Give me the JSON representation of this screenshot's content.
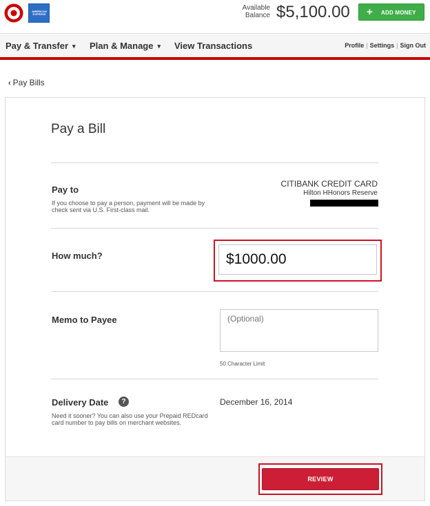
{
  "header": {
    "available_label": "Available\nBalance",
    "balance": "$5,100.00",
    "add_money_label": "ADD MONEY",
    "amex_text": "AMERICAN EXPRESS",
    "icons": {
      "target_logo": "target-logo",
      "amex_logo": "amex-logo",
      "add_icon": "plus-icon"
    },
    "colors": {
      "accent_red": "#cc0000",
      "add_money_green": "#3fae49"
    }
  },
  "nav": {
    "pay_transfer": "Pay & Transfer",
    "plan_manage": "Plan & Manage",
    "view_transactions": "View Transactions",
    "caret": "▾",
    "util": {
      "profile": "Profile",
      "settings": "Settings",
      "sign_out": "Sign Out",
      "separator": "|"
    }
  },
  "breadcrumb": {
    "chevron": "‹",
    "label": "Pay Bills"
  },
  "form": {
    "title": "Pay a Bill",
    "pay_to": {
      "heading": "Pay to",
      "note": "If you choose to pay a person, payment will be made by check sent via U.S. First-class mail.",
      "payee_name": "CITIBANK CREDIT CARD",
      "payee_sub": "Hilton HHonors Reserve"
    },
    "amount": {
      "heading": "How much?",
      "value": "$1000.00"
    },
    "memo": {
      "heading": "Memo to Payee",
      "placeholder": "(Optional)",
      "limit": "50 Character Limit"
    },
    "delivery": {
      "heading": "Delivery Date",
      "help": "?",
      "note": "Need it sooner? You can also use your Prepaid REDcard card number to pay bills on merchant websites.",
      "date": "December 16, 2014"
    },
    "review_label": "REVIEW",
    "colors": {
      "review_red": "#cc1f36",
      "highlight_red": "#cc1122"
    }
  }
}
